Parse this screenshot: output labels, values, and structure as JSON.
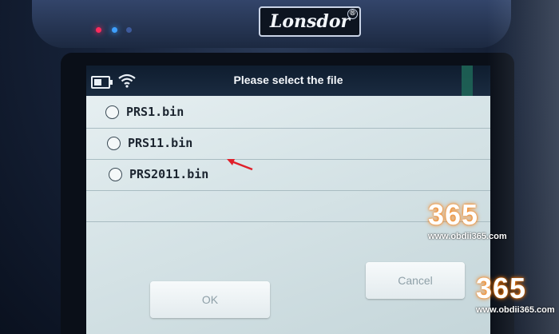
{
  "device": {
    "brand": "Lonsdor",
    "reg_mark": "®"
  },
  "status": {
    "battery_icon": "battery-icon",
    "wifi_icon": "wifi-icon"
  },
  "header": {
    "title": "Please select the file"
  },
  "files": [
    {
      "label": "PRS1.bin"
    },
    {
      "label": "PRS11.bin"
    },
    {
      "label": "PRS2011.bin"
    }
  ],
  "buttons": {
    "ok": "OK",
    "cancel": "Cancel"
  },
  "watermarks": [
    {
      "number": "365",
      "url": "www.obdii365.com"
    },
    {
      "number": "365",
      "url": "www.obdii365.com"
    }
  ],
  "colors": {
    "accent_orange": "#ff7a00",
    "arrow_red": "#e0202a",
    "titlebar": "#0f1d2f"
  }
}
